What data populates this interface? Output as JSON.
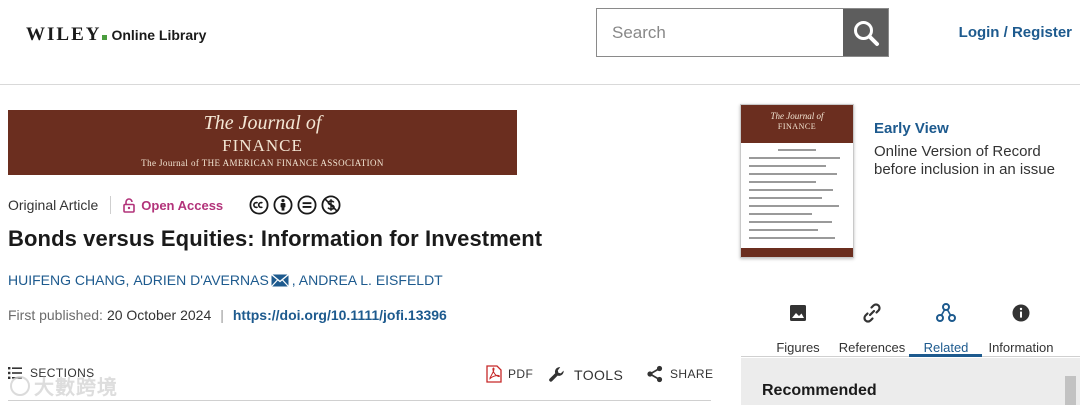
{
  "header": {
    "logo_word": "WILEY",
    "logo_sub": "Online Library",
    "search_placeholder": "Search",
    "login_label": "Login / Register"
  },
  "journal_banner": {
    "title": "The Journal of",
    "finance": "FINANCE",
    "subtitle": "The Journal of THE AMERICAN FINANCE ASSOCIATION"
  },
  "article": {
    "type": "Original Article",
    "access": "Open Access",
    "license_icons": [
      "cc-icon",
      "by-icon",
      "nd-icon",
      "nc-icon"
    ],
    "title": "Bonds versus Equities: Information for Investment",
    "authors": [
      {
        "name": "HUIFENG CHANG,"
      },
      {
        "name": "ADRIEN D'AVERNAS"
      },
      {
        "name": ", ANDREA L. EISFELDT"
      }
    ],
    "first_published_label": "First published:",
    "first_published_date": "20 October 2024",
    "doi": "https://doi.org/10.1111/jofi.13396"
  },
  "toolbar": {
    "sections_label": "SECTIONS",
    "pdf_label": "PDF",
    "tools_label": "TOOLS",
    "share_label": "SHARE"
  },
  "watermark": {
    "text": "大數跨境"
  },
  "issue": {
    "cover_title": "The Journal of",
    "cover_finance": "FINANCE",
    "status": "Early View",
    "description": "Online Version of Record before inclusion in an issue"
  },
  "side_tabs": [
    {
      "label": "Figures",
      "icon": "image-icon",
      "active": false
    },
    {
      "label": "References",
      "icon": "link-icon",
      "active": false
    },
    {
      "label": "Related",
      "icon": "related-icon",
      "active": true
    },
    {
      "label": "Information",
      "icon": "info-icon",
      "active": false
    }
  ],
  "recommended": {
    "heading": "Recommended"
  },
  "colors": {
    "brand_blue": "#1d5a8e",
    "journal_brown": "#6b2e1f",
    "open_access_pink": "#b2337a",
    "wiley_green": "#4a9d3e"
  }
}
